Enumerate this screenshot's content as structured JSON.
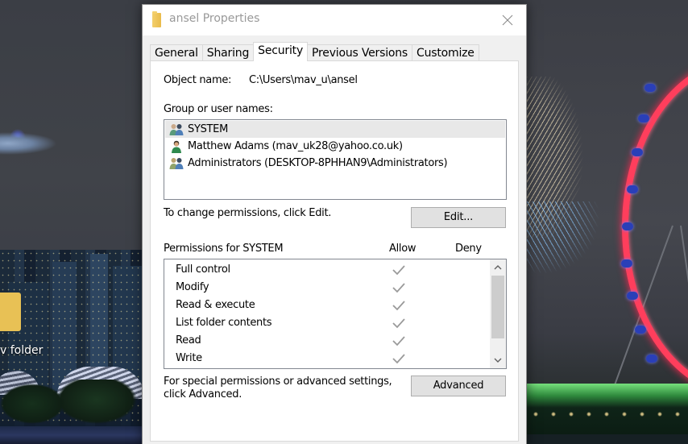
{
  "desktop": {
    "folder_label": "v folder"
  },
  "dialog": {
    "title": "ansel Properties",
    "tabs": [
      {
        "label": "General",
        "active": false
      },
      {
        "label": "Sharing",
        "active": false
      },
      {
        "label": "Security",
        "active": true
      },
      {
        "label": "Previous Versions",
        "active": false
      },
      {
        "label": "Customize",
        "active": false
      }
    ],
    "security": {
      "object_name_label": "Object name:",
      "object_name_value": "C:\\Users\\mav_u\\ansel",
      "group_label": "Group or user names:",
      "users": [
        {
          "name": "SYSTEM",
          "icon": "group-users-icon",
          "selected": true
        },
        {
          "name": "Matthew Adams (mav_uk28@yahoo.co.uk)",
          "icon": "single-user-icon",
          "selected": false
        },
        {
          "name": "Administrators (DESKTOP-8PHHAN9\\Administrators)",
          "icon": "group-users-icon",
          "selected": false
        }
      ],
      "change_hint": "To change permissions, click Edit.",
      "edit_button": "Edit...",
      "permissions_for": "Permissions for SYSTEM",
      "allow_header": "Allow",
      "deny_header": "Deny",
      "permissions": [
        {
          "name": "Full control",
          "allow": true,
          "deny": false
        },
        {
          "name": "Modify",
          "allow": true,
          "deny": false
        },
        {
          "name": "Read & execute",
          "allow": true,
          "deny": false
        },
        {
          "name": "List folder contents",
          "allow": true,
          "deny": false
        },
        {
          "name": "Read",
          "allow": true,
          "deny": false
        },
        {
          "name": "Write",
          "allow": true,
          "deny": false
        }
      ],
      "advanced_hint_line1": "For special permissions or advanced settings,",
      "advanced_hint_line2": "click Advanced.",
      "advanced_button": "Advanced"
    }
  },
  "colors": {
    "checkmark": "#9a9a9a",
    "selected_row": "#e8e8e8",
    "button_bg": "#e1e1e1",
    "title_text": "#999999"
  }
}
